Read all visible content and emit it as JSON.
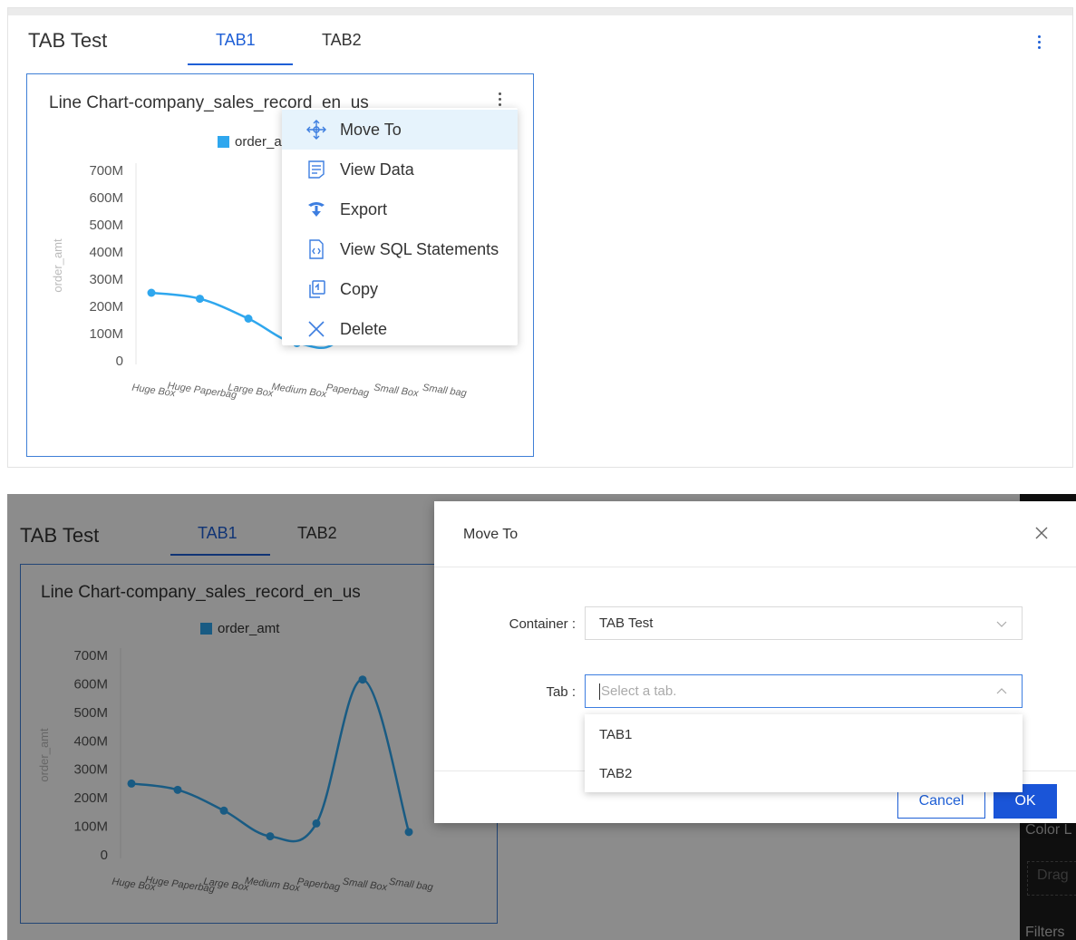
{
  "dashboard": {
    "title": "TAB Test",
    "tabs": [
      {
        "label": "TAB1",
        "active": true
      },
      {
        "label": "TAB2",
        "active": false
      }
    ]
  },
  "chart_card": {
    "title_visible_panel1": "Line Chart-company_sales_record_en_us",
    "title_full": "Line Chart-company_sales_record_en_us"
  },
  "chart_data": {
    "type": "line",
    "title": "Line Chart-company_sales_record_en_us",
    "categories": [
      "Huge Box",
      "Huge Paperbag",
      "Large Box",
      "Medium Box",
      "Paperbag",
      "Small Box",
      "Small bag"
    ],
    "series": [
      {
        "name": "order_amt",
        "values": [
          250,
          228,
          155,
          65,
          110,
          615,
          80
        ]
      }
    ],
    "y_ticks": [
      "0",
      "100M",
      "200M",
      "300M",
      "400M",
      "500M",
      "600M",
      "700M"
    ],
    "ylabel": "order_amt",
    "ylim": [
      0,
      700
    ],
    "y_unit": "M",
    "smooth": true,
    "color": "#2fa7ee",
    "legend_position": "top-center"
  },
  "context_menu": {
    "items": [
      {
        "label": "Move To",
        "icon": "move-icon",
        "highlighted": true
      },
      {
        "label": "View Data",
        "icon": "view-data-icon"
      },
      {
        "label": "Export",
        "icon": "export-icon"
      },
      {
        "label": "View SQL Statements",
        "icon": "sql-icon"
      },
      {
        "label": "Copy",
        "icon": "copy-icon"
      },
      {
        "label": "Delete",
        "icon": "delete-icon"
      }
    ]
  },
  "modal": {
    "title": "Move To",
    "container_label": "Container :",
    "container_value": "TAB Test",
    "tab_label": "Tab :",
    "tab_placeholder": "Select a tab.",
    "tab_options": [
      "TAB1",
      "TAB2"
    ],
    "cancel_label": "Cancel",
    "ok_label": "OK"
  },
  "side_panel": {
    "color_label": "Color L",
    "drag_label": "Drag",
    "filters_label": "Filters"
  },
  "colors": {
    "accent": "#1e5fd6",
    "series": "#2fa7ee",
    "ok_button": "#1a55d8"
  }
}
